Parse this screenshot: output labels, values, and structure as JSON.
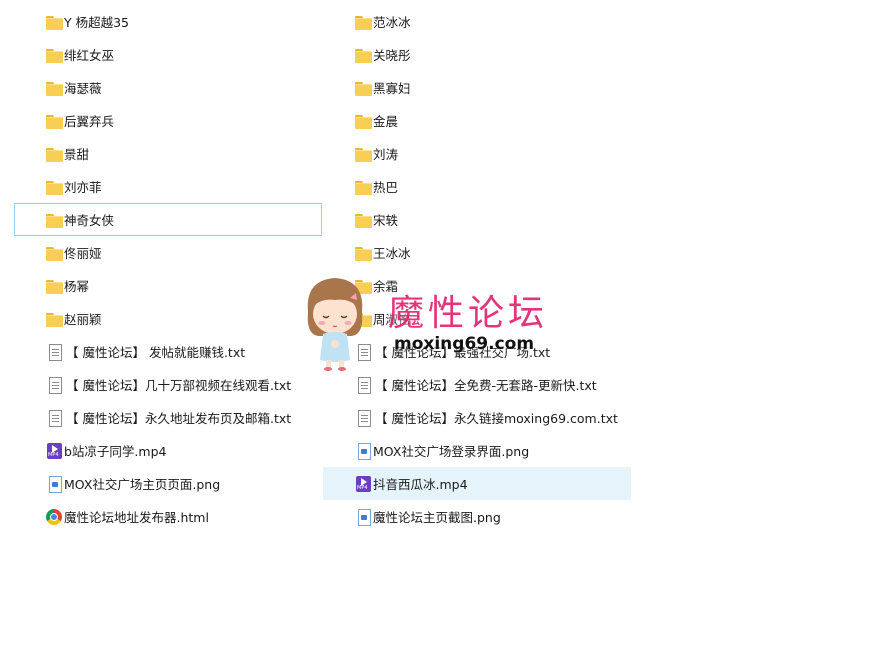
{
  "left_column": [
    {
      "type": "folder",
      "name": "Y 杨超越35"
    },
    {
      "type": "folder",
      "name": "绯红女巫"
    },
    {
      "type": "folder",
      "name": "海瑟薇"
    },
    {
      "type": "folder",
      "name": "后翼弃兵"
    },
    {
      "type": "folder",
      "name": "景甜"
    },
    {
      "type": "folder",
      "name": "刘亦菲"
    },
    {
      "type": "folder",
      "name": "神奇女侠"
    },
    {
      "type": "folder",
      "name": "佟丽娅"
    },
    {
      "type": "folder",
      "name": "杨幂"
    },
    {
      "type": "folder",
      "name": "赵丽颖"
    },
    {
      "type": "txt",
      "name": "【 魔性论坛】 发帖就能赚钱.txt"
    },
    {
      "type": "txt",
      "name": "【 魔性论坛】几十万部视频在线观看.txt"
    },
    {
      "type": "txt",
      "name": "【 魔性论坛】永久地址发布页及邮箱.txt"
    },
    {
      "type": "video",
      "name": "b站凉子同学.mp4"
    },
    {
      "type": "png",
      "name": "MOX社交广场主页页面.png"
    },
    {
      "type": "html",
      "name": "魔性论坛地址发布器.html"
    }
  ],
  "right_column": [
    {
      "type": "folder",
      "name": "范冰冰"
    },
    {
      "type": "folder",
      "name": "关晓彤"
    },
    {
      "type": "folder",
      "name": "黑寡妇"
    },
    {
      "type": "folder",
      "name": "金晨"
    },
    {
      "type": "folder",
      "name": "刘涛"
    },
    {
      "type": "folder",
      "name": "热巴"
    },
    {
      "type": "folder",
      "name": "宋轶"
    },
    {
      "type": "folder",
      "name": "王冰冰"
    },
    {
      "type": "folder",
      "name": "余霜"
    },
    {
      "type": "folder",
      "name": "周淑怡"
    },
    {
      "type": "txt",
      "name": "【 魔性论坛】最强社交广场.txt"
    },
    {
      "type": "txt",
      "name": "【 魔性论坛】全免费-无套路-更新快.txt"
    },
    {
      "type": "txt",
      "name": "【 魔性论坛】永久链接moxing69.com.txt"
    },
    {
      "type": "png",
      "name": "MOX社交广场登录界面.png"
    },
    {
      "type": "video",
      "name": "抖音西瓜冰.mp4"
    },
    {
      "type": "png",
      "name": "魔性论坛主页截图.png"
    }
  ],
  "state": {
    "focused_item": "神奇女侠",
    "selected_item": "抖音西瓜冰.mp4"
  },
  "icons": {
    "folder": "folder-icon",
    "txt": "text-file-icon",
    "png": "image-file-icon",
    "video": "video-file-icon",
    "html": "chrome-icon"
  },
  "video_icon_tag": "MP4",
  "watermark": {
    "title": "魔性论坛",
    "url": "moxing69.com",
    "color": "#e0206e"
  },
  "colors": {
    "selection_bg": "#e5f3fb",
    "focus_border": "#99d1ea",
    "folder": "#f8cf54"
  }
}
